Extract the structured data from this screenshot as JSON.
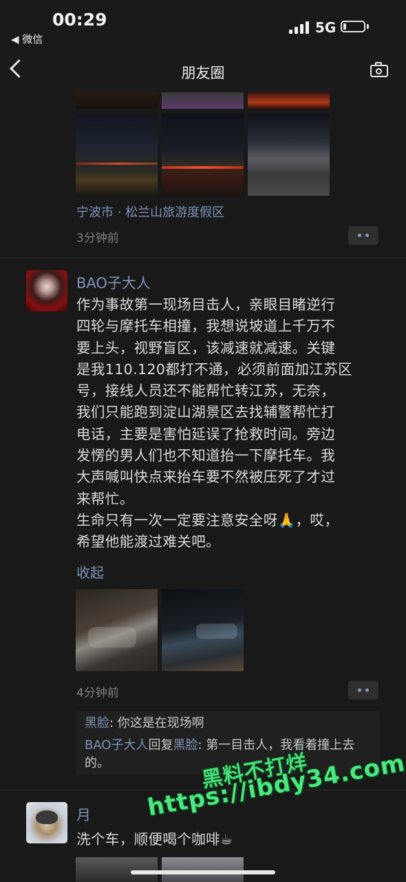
{
  "status_bar": {
    "time": "00:29",
    "back_app": "◀ 微信",
    "network": "5G",
    "battery_level": 0.15
  },
  "nav": {
    "title": "朋友圈"
  },
  "post1": {
    "location": "宁波市 · 松兰山旅游度假区",
    "time": "3分钟前"
  },
  "post2": {
    "author": "BAO子大人",
    "content": "作为事故第一现场目击人，亲眼目睹逆行\n四轮与摩托车相撞，我想说坡道上千万不\n要上头，视野盲区，该减速就减速。关键\n是我110.120都打不通，必须前面加江苏区\n号，接线人员还不能帮忙转江苏，无奈，\n我们只能跑到淀山湖景区去找辅警帮忙打\n电话，主要是害怕延误了抢救时间。旁边\n发愣的男人们也不知道抬一下摩托车。我\n大声喊叫快点来抬车要不然被压死了才过\n来帮忙。\n生命只有一次一定要注意安全呀🙏，哎，\n希望他能渡过难关吧。",
    "collapse": "收起",
    "time": "4分钟前",
    "comments": [
      {
        "name": "黑脸",
        "sep": ": ",
        "text": "你这是在现场啊"
      },
      {
        "name": "BAO子大人",
        "reply_word": "回复",
        "reply_to": "黑脸",
        "sep": ": ",
        "text": "第一目击人，我看着撞上去的。"
      }
    ]
  },
  "post3": {
    "author": "月",
    "content": "洗个车，顺便喝个咖啡☕"
  },
  "watermark": {
    "line1": "黑料不打烊",
    "line2": "https://ibdy34.com"
  }
}
